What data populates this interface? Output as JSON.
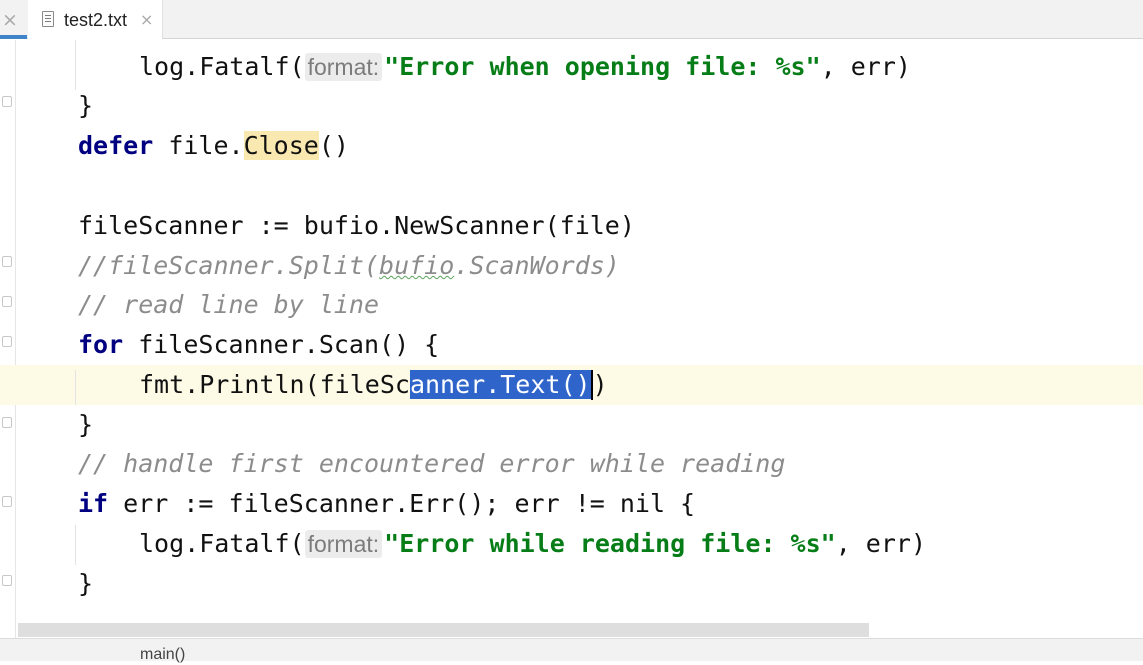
{
  "tabs": {
    "left_close_glyph": "×",
    "active_tab": {
      "label": "test2.txt",
      "close_glyph": "×"
    },
    "accent_color": "#4083c9"
  },
  "editor": {
    "hint_label": "format:",
    "lines": {
      "l1": {
        "call": "log.Fatalf(",
        "str": "\"Error when opening file: %s\"",
        "rest": ", err)"
      },
      "l2": {
        "text": "}"
      },
      "l3": {
        "kw": "defer",
        "pre": " file.",
        "method": "Close",
        "post": "()"
      },
      "l5": {
        "text": "fileScanner := bufio.NewScanner(file)"
      },
      "l6": {
        "pre": "//fileScanner.Split(",
        "squiggle": "bufio",
        "post": ".ScanWords)"
      },
      "l7": {
        "text": "// read line by line"
      },
      "l8": {
        "kw": "for",
        "rest": " fileScanner.Scan() {"
      },
      "l9": {
        "pre": "fmt.Println(fileSc",
        "selected": "anner.Text()",
        "post": ")"
      },
      "l10": {
        "text": "}"
      },
      "l11": {
        "text": "// handle first encountered error while reading"
      },
      "l12": {
        "kw": "if",
        "rest": " err := fileScanner.Err(); err != nil {"
      },
      "l13": {
        "call": "log.Fatalf(",
        "str": "\"Error while reading file: %s\"",
        "rest": ", err)"
      },
      "l14": {
        "text": "}"
      }
    },
    "colors": {
      "keyword": "#000080",
      "string": "#067d17",
      "comment": "#8c8c8c",
      "selection": "#2f65ca",
      "current_line": "#fdfbe6"
    }
  },
  "statusbar": {
    "breadcrumb": "main()"
  }
}
